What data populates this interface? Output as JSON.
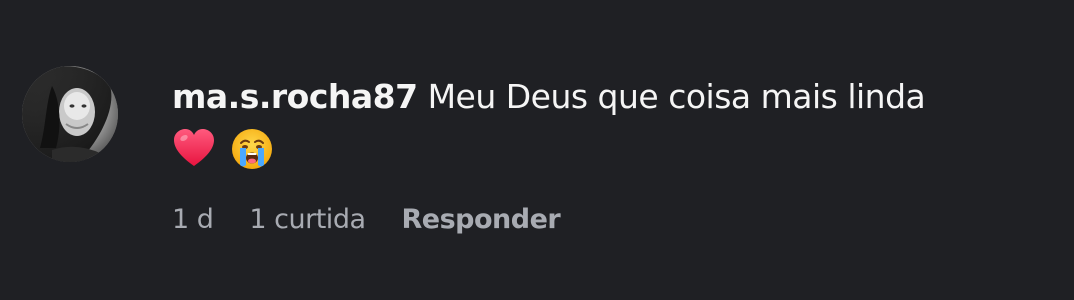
{
  "comment": {
    "username": "ma.s.rocha87",
    "text": "Meu Deus que coisa mais linda",
    "emojis": [
      "heart-icon",
      "crying-face-icon"
    ],
    "time": "1 d",
    "likes": "1 curtida",
    "reply_label": "Responder"
  },
  "colors": {
    "background": "#1f2024",
    "text": "#f5f5f5",
    "meta": "#a8abb2",
    "heart": "#ff2f59"
  }
}
